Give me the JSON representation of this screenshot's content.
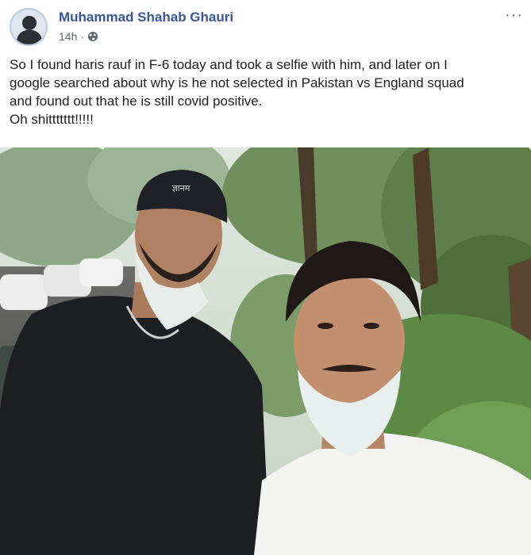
{
  "author": {
    "name": "Muhammad Shahab Ghauri",
    "time": "14h",
    "separator": "·"
  },
  "icons": {
    "privacy": "globe-icon",
    "more": "more-horizontal-icon"
  },
  "more_glyph": "···",
  "post_text": [
    "So I found haris rauf in F-6 today and took a selfie with him, and later on I",
    "google searched about why is he not selected in Pakistan vs England squad",
    "and found out that he is still covid positive.",
    "Oh shittttttt!!!!!"
  ],
  "cap_logo_text": "ज्ञानम",
  "colors": {
    "name": "#385898",
    "meta": "#606770",
    "text": "#1c1e21"
  }
}
